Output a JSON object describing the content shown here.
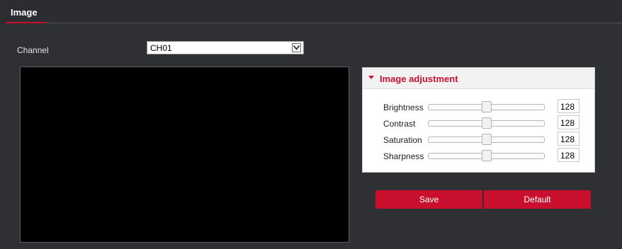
{
  "header": {
    "title": "Image"
  },
  "channel": {
    "label": "Channel",
    "selected": "CH01"
  },
  "adjustment": {
    "title": "Image adjustment",
    "rows": [
      {
        "label": "Brightness",
        "value": "128",
        "level": 0.5
      },
      {
        "label": "Contrast",
        "value": "128",
        "level": 0.5
      },
      {
        "label": "Saturation",
        "value": "128",
        "level": 0.5
      },
      {
        "label": "Sharpness",
        "value": "128",
        "level": 0.5
      }
    ]
  },
  "buttons": {
    "save": "Save",
    "default": "Default"
  },
  "colors": {
    "accent": "#c8102e",
    "background": "#2e3033",
    "preview": "#000000"
  }
}
